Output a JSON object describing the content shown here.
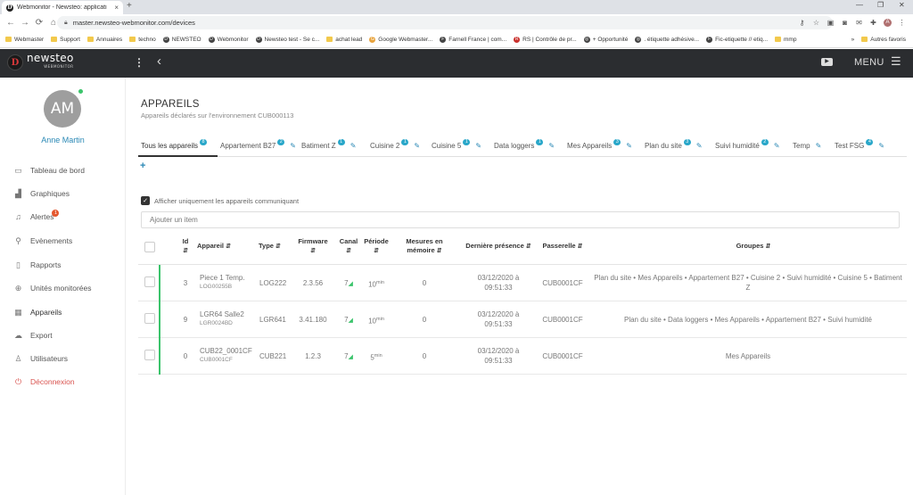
{
  "browser": {
    "tab_title": "Webmonitor - Newsteo: applicati",
    "url": "master.newsteo-webmonitor.com/devices",
    "bookmarks": [
      "Webmaster",
      "Support",
      "Annuaires",
      "techno",
      "NEWSTEO",
      "Webmonitor",
      "Newsteo test - Se c...",
      "achat lead",
      "Google Webmaster...",
      "Farnell France | com...",
      "RS | Contrôle de pr...",
      "+ Opportunité",
      ". étiquette adhésive...",
      "Fic-etiquette // etiq...",
      "mmp"
    ],
    "bookmarks_more": "»",
    "other_bookmarks": "Autres favoris"
  },
  "app": {
    "logo_text": "newsteo",
    "logo_sub": "WEBMONITOR",
    "menu_label": "MENU"
  },
  "user": {
    "initials": "AM",
    "name": "Anne Martin"
  },
  "sidebar": {
    "items": [
      {
        "label": "Tableau de bord",
        "icon": "monitor-icon"
      },
      {
        "label": "Graphiques",
        "icon": "bar-chart-icon"
      },
      {
        "label": "Alertes",
        "icon": "bell-icon",
        "badge": "1"
      },
      {
        "label": "Evènements",
        "icon": "pin-icon"
      },
      {
        "label": "Rapports",
        "icon": "document-icon"
      },
      {
        "label": "Unités monitorées",
        "icon": "crosshair-icon"
      },
      {
        "label": "Appareils",
        "icon": "grid-icon",
        "active": true
      },
      {
        "label": "Export",
        "icon": "cloud-upload-icon"
      },
      {
        "label": "Utilisateurs",
        "icon": "user-icon"
      },
      {
        "label": "Déconnexion",
        "icon": "power-icon"
      }
    ]
  },
  "page": {
    "title": "APPAREILS",
    "subtitle": "Appareils déclarés sur l'environnement CUB000113",
    "add_tab": "+",
    "checkbox_label": "Afficher uniquement les appareils communiquant",
    "search_placeholder": "Ajouter un item"
  },
  "tabs": [
    {
      "label": "Tous les appareils",
      "count": "8",
      "active": true,
      "editable": false
    },
    {
      "label": "Appartement B27",
      "count": "2",
      "editable": true
    },
    {
      "label": "Batiment Z",
      "count": "1",
      "editable": true
    },
    {
      "label": "Cuisine 2",
      "count": "1",
      "editable": true
    },
    {
      "label": "Cuisine 5",
      "count": "1",
      "editable": true
    },
    {
      "label": "Data loggers",
      "count": "1",
      "editable": true
    },
    {
      "label": "Mes Appareils",
      "count": "3",
      "editable": true
    },
    {
      "label": "Plan du site",
      "count": "3",
      "editable": true
    },
    {
      "label": "Suivi humidité",
      "count": "2",
      "editable": true
    },
    {
      "label": "Temp",
      "count": "",
      "editable": true
    },
    {
      "label": "Test FSG",
      "count": "4",
      "editable": true
    }
  ],
  "table": {
    "headers": {
      "id": "Id",
      "appareil": "Appareil",
      "type": "Type",
      "firmware": "Firmware",
      "canal": "Canal",
      "periode": "Période",
      "mesures": "Mesures en mémoire",
      "presence": "Dernière présence",
      "passerelle": "Passerelle",
      "groupes": "Groupes"
    },
    "sort_icon": "⇵",
    "rows": [
      {
        "id": "3",
        "name": "Piece 1 Temp.",
        "serial": "LOG00255B",
        "type": "LOG222",
        "firmware": "2.3.56",
        "canal": "7",
        "periode": "10",
        "periode_unit": "min",
        "mesures": "0",
        "presence": "03/12/2020 à 09:51:33",
        "passerelle": "CUB0001CF",
        "groupes": "Plan du site • Mes Appareils • Appartement B27 • Cuisine 2 • Suivi humidité • Cuisine 5 • Batiment Z"
      },
      {
        "id": "9",
        "name": "LGR64 Salle2",
        "serial": "LGR0024BD",
        "type": "LGR641",
        "firmware": "3.41.180",
        "canal": "7",
        "periode": "10",
        "periode_unit": "min",
        "mesures": "0",
        "presence": "03/12/2020 à 09:51:33",
        "passerelle": "CUB0001CF",
        "groupes": "Plan du site • Data loggers • Mes Appareils • Appartement B27 • Suivi humidité"
      },
      {
        "id": "0",
        "name": "CUB22_0001CF",
        "serial": "CUB0001CF",
        "type": "CUB221",
        "firmware": "1.2.3",
        "canal": "7",
        "periode": "5",
        "periode_unit": "min",
        "mesures": "0",
        "presence": "03/12/2020 à 09:51:33",
        "passerelle": "CUB0001CF",
        "groupes": "Mes Appareils"
      }
    ]
  },
  "colors": {
    "accent": "#2a88b5",
    "badge": "#29a7c9",
    "online": "#3bc46b",
    "header": "#2b2d30",
    "logout": "#d9534f"
  }
}
